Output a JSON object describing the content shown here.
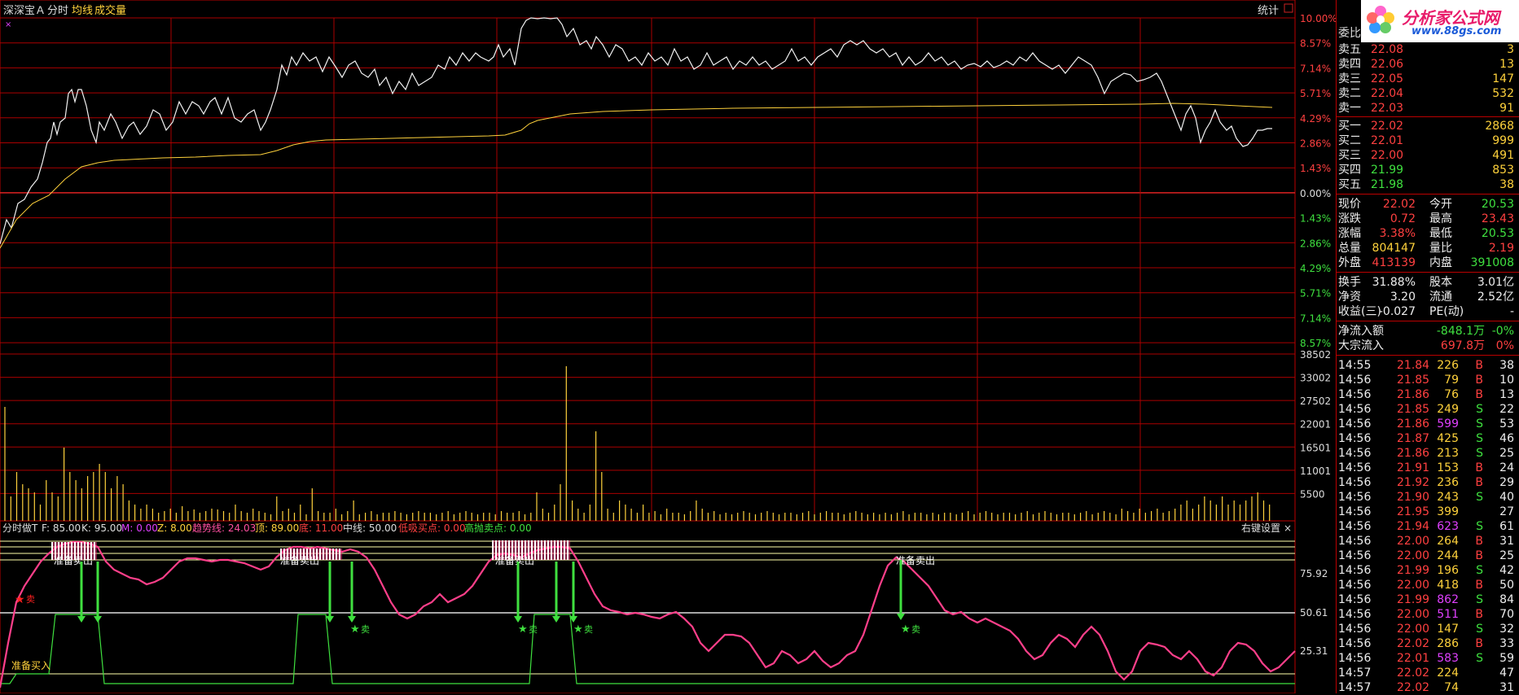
{
  "top_bar": {
    "stock_name": "深深宝Ａ",
    "tab_timeshare": "分时",
    "tab_avg": "均线",
    "tab_volume": "成交量",
    "stats_btn": "统计"
  },
  "indicator_bar": {
    "name": "分时做T",
    "f": "F: 85.00",
    "k": "K: 95.00",
    "m": "M: 0.00",
    "z": "Z: 8.00",
    "trend": "趋势线: 24.03",
    "top": "顶: 89.00",
    "bottom": "底: 11.00",
    "mid": "中线: 50.00",
    "low_buy": "低吸买点: 0.00",
    "high_sell": "高抛卖点: 0.00",
    "settings": "右键设置"
  },
  "axis": {
    "price_pct": [
      "10.00%",
      "8.57%",
      "7.14%",
      "5.71%",
      "4.29%",
      "2.86%",
      "1.43%",
      "0.00%",
      "1.43%",
      "2.86%",
      "4.29%",
      "5.71%",
      "7.14%",
      "8.57%"
    ],
    "volume": [
      "38502",
      "33002",
      "27502",
      "22001",
      "16501",
      "11001",
      "5500"
    ],
    "indicator": [
      "75.92",
      "50.61",
      "25.31"
    ]
  },
  "annotations": {
    "prepare_sell": "准备卖出",
    "sell": "卖",
    "prepare_buy": "准备买入"
  },
  "logo": {
    "title": "分析家公式网",
    "url": "www.88gs.com"
  },
  "order_book": {
    "title": "委比",
    "sells": [
      {
        "label": "卖五",
        "price": "22.08",
        "vol": "3"
      },
      {
        "label": "卖四",
        "price": "22.06",
        "vol": "13"
      },
      {
        "label": "卖三",
        "price": "22.05",
        "vol": "147"
      },
      {
        "label": "卖二",
        "price": "22.04",
        "vol": "532"
      },
      {
        "label": "卖一",
        "price": "22.03",
        "vol": "91"
      }
    ],
    "buys": [
      {
        "label": "买一",
        "price": "22.02",
        "vol": "2868"
      },
      {
        "label": "买二",
        "price": "22.01",
        "vol": "999"
      },
      {
        "label": "买三",
        "price": "22.00",
        "vol": "491"
      },
      {
        "label": "买四",
        "price": "21.99",
        "vol": "853"
      },
      {
        "label": "买五",
        "price": "21.98",
        "vol": "38"
      }
    ]
  },
  "quote": [
    {
      "l1": "现价",
      "v1": "22.02",
      "l2": "今开",
      "v2": "20.53"
    },
    {
      "l1": "涨跌",
      "v1": "0.72",
      "l2": "最高",
      "v2": "23.43"
    },
    {
      "l1": "涨幅",
      "v1": "3.38%",
      "l2": "最低",
      "v2": "20.53"
    },
    {
      "l1": "总量",
      "v1": "804147",
      "l2": "量比",
      "v2": "2.19"
    },
    {
      "l1": "外盘",
      "v1": "413139",
      "l2": "内盘",
      "v2": "391008"
    }
  ],
  "fundamentals": [
    {
      "l1": "换手",
      "v1": "31.88%",
      "l2": "股本",
      "v2": "3.01亿"
    },
    {
      "l1": "净资",
      "v1": "3.20",
      "l2": "流通",
      "v2": "2.52亿"
    },
    {
      "l1": "收益(三)",
      "v1": "-0.027",
      "l2": "PE(动)",
      "v2": "-"
    }
  ],
  "flows": [
    {
      "label": "净流入额",
      "value": "-848.1万",
      "pct": "-0%"
    },
    {
      "label": "大宗流入",
      "value": "697.8万",
      "pct": "0%"
    }
  ],
  "ticks": [
    {
      "t": "14:55",
      "p": "21.84",
      "v": "226",
      "s": "B",
      "n": "38"
    },
    {
      "t": "14:56",
      "p": "21.85",
      "v": "79",
      "s": "B",
      "n": "10"
    },
    {
      "t": "14:56",
      "p": "21.86",
      "v": "76",
      "s": "B",
      "n": "13"
    },
    {
      "t": "14:56",
      "p": "21.85",
      "v": "249",
      "s": "S",
      "n": "22"
    },
    {
      "t": "14:56",
      "p": "21.86",
      "v": "599",
      "s": "S",
      "n": "53"
    },
    {
      "t": "14:56",
      "p": "21.87",
      "v": "425",
      "s": "S",
      "n": "46"
    },
    {
      "t": "14:56",
      "p": "21.86",
      "v": "213",
      "s": "S",
      "n": "25"
    },
    {
      "t": "14:56",
      "p": "21.91",
      "v": "153",
      "s": "B",
      "n": "24"
    },
    {
      "t": "14:56",
      "p": "21.92",
      "v": "236",
      "s": "B",
      "n": "29"
    },
    {
      "t": "14:56",
      "p": "21.90",
      "v": "243",
      "s": "S",
      "n": "40"
    },
    {
      "t": "14:56",
      "p": "21.95",
      "v": "399",
      "s": "",
      "n": "27"
    },
    {
      "t": "14:56",
      "p": "21.94",
      "v": "623",
      "s": "S",
      "n": "61"
    },
    {
      "t": "14:56",
      "p": "22.00",
      "v": "264",
      "s": "B",
      "n": "31"
    },
    {
      "t": "14:56",
      "p": "22.00",
      "v": "244",
      "s": "B",
      "n": "25"
    },
    {
      "t": "14:56",
      "p": "21.99",
      "v": "196",
      "s": "S",
      "n": "42"
    },
    {
      "t": "14:56",
      "p": "22.00",
      "v": "418",
      "s": "B",
      "n": "50"
    },
    {
      "t": "14:56",
      "p": "21.99",
      "v": "862",
      "s": "S",
      "n": "84"
    },
    {
      "t": "14:56",
      "p": "22.00",
      "v": "511",
      "s": "B",
      "n": "70"
    },
    {
      "t": "14:56",
      "p": "22.00",
      "v": "147",
      "s": "S",
      "n": "32"
    },
    {
      "t": "14:56",
      "p": "22.02",
      "v": "286",
      "s": "B",
      "n": "33"
    },
    {
      "t": "14:56",
      "p": "22.01",
      "v": "583",
      "s": "S",
      "n": "59"
    },
    {
      "t": "14:57",
      "p": "22.02",
      "v": "224",
      "s": "",
      "n": "47"
    },
    {
      "t": "14:57",
      "p": "22.02",
      "v": "74",
      "s": "",
      "n": "31"
    }
  ]
}
